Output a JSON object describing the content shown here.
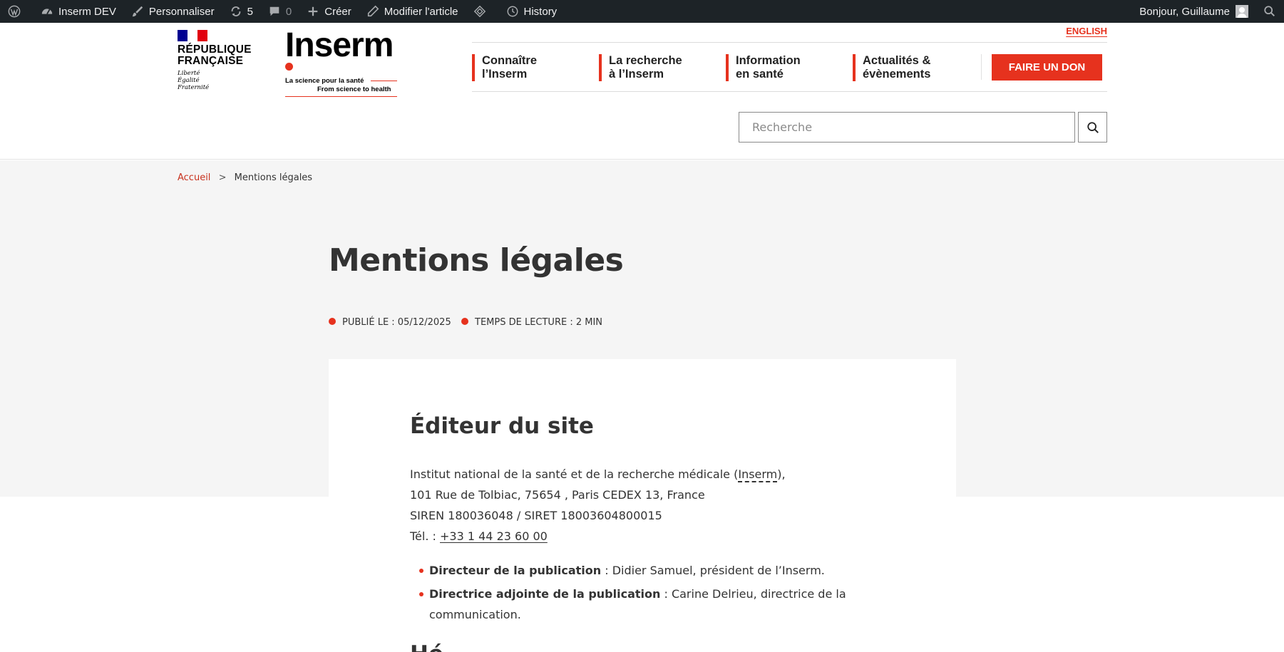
{
  "admin_bar": {
    "site_name": "Inserm DEV",
    "customize": "Personnaliser",
    "updates_count": "5",
    "comments_count": "0",
    "new_label": "Créer",
    "edit_label": "Modifier l'article",
    "history_label": "History",
    "greeting": "Bonjour, Guillaume"
  },
  "header": {
    "republique": "RÉPUBLIQUE\nFRANÇAISE",
    "motto": "Liberté\nÉgalité\nFraternité",
    "logo_word": "Inserm",
    "tagline_fr": "La science pour la santé",
    "tagline_en": "From science to health",
    "english_link": "ENGLISH",
    "nav": [
      {
        "label": "Connaître\nl’Inserm"
      },
      {
        "label": "La recherche\nà l’Inserm"
      },
      {
        "label": "Information\nen santé"
      },
      {
        "label": "Actualités &\névènements"
      }
    ],
    "donate_label": "FAIRE UN DON",
    "search_placeholder": "Recherche"
  },
  "breadcrumb": {
    "home": "Accueil",
    "separator": ">",
    "current": "Mentions légales"
  },
  "page": {
    "title": "Mentions légales",
    "published": "PUBLIÉ LE : 05/12/2025",
    "reading_time": "TEMPS DE LECTURE : 2 MIN"
  },
  "content": {
    "section_title": "Éditeur du site",
    "address_line1_a": "Institut national de la santé et de la recherche médicale (",
    "address_line1_abbr": "Inserm",
    "address_line1_b": "),",
    "address_line2": "101 Rue de Tolbiac, 75654 , Paris CEDEX 13, France",
    "address_line3": "SIREN 180036048 / SIRET 18003604800015",
    "tel_label": "Tél. : ",
    "tel_value": "+33 1 44 23 60 00",
    "list": [
      {
        "bold": "Directeur de la publication",
        "text": " : Didier Samuel, président de l’Inserm."
      },
      {
        "bold": "Directrice adjointe de la publication",
        "text": " : Carine Delrieu, directrice de la communication."
      }
    ],
    "next_heading_partial": "Hé"
  },
  "colors": {
    "accent": "#e6321e",
    "admin_bar": "#1d2327",
    "band": "#f5f5f5"
  }
}
